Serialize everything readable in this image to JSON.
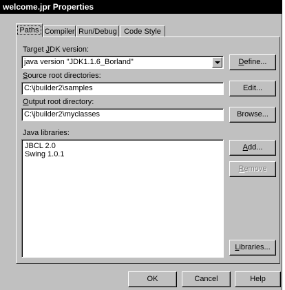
{
  "window": {
    "title": "welcome.jpr Properties"
  },
  "tabs": [
    "Paths",
    "Compiler",
    "Run/Debug",
    "Code Style"
  ],
  "target_jdk": {
    "label_pre": "Target ",
    "label_key": "J",
    "label_post": "DK version:",
    "value": "java version \"JDK1.1.6_Borland\"",
    "button_key": "D",
    "button_rest": "efine..."
  },
  "source_root": {
    "label_key": "S",
    "label_rest": "ource root directories:",
    "value": "C:\\jbuilder2\\samples",
    "button": "Edit..."
  },
  "output_root": {
    "label_key": "O",
    "label_rest": "utput root directory:",
    "value": "C:\\jbuilder2\\myclasses",
    "button": "Browse..."
  },
  "java_libraries": {
    "label": "Java libraries:",
    "items": [
      "JBCL 2.0",
      "Swing 1.0.1"
    ],
    "add_key": "A",
    "add_rest": "dd...",
    "remove_key": "R",
    "remove_rest": "emove",
    "libraries_key": "L",
    "libraries_rest": "ibraries..."
  },
  "footer": {
    "ok": "OK",
    "cancel": "Cancel",
    "help": "Help"
  }
}
